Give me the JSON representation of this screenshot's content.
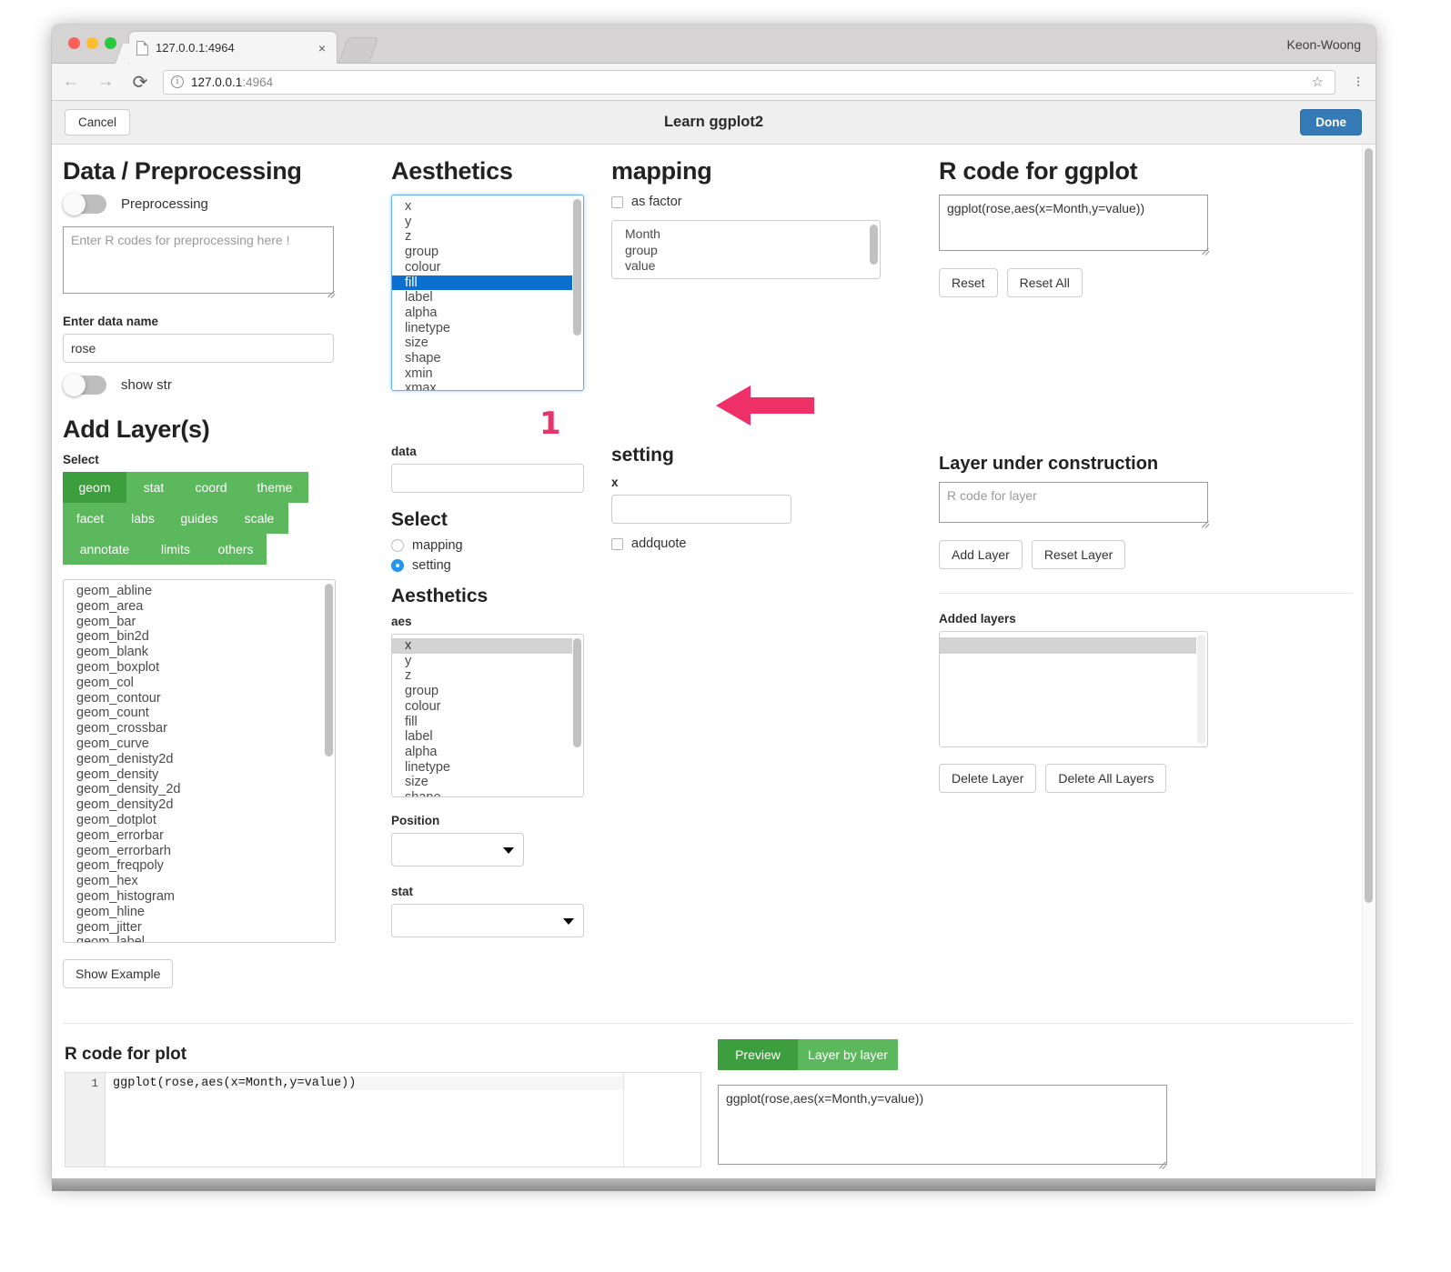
{
  "browser": {
    "tab_title": "127.0.0.1:4964",
    "tab_close": "×",
    "profile": "Keon-Woong",
    "url_host": "127.0.0.1",
    "url_port": ":4964",
    "back_icon": "←",
    "forward_icon": "→",
    "reload_icon": "⟳",
    "info_icon": "i",
    "star_icon": "☆"
  },
  "app": {
    "cancel_label": "Cancel",
    "title": "Learn ggplot2",
    "done_label": "Done"
  },
  "data_section": {
    "heading": "Data / Preprocessing",
    "preprocessing_toggle_label": "Preprocessing",
    "preprocessing_placeholder": "Enter R codes for preprocessing here !",
    "preprocessing_value": "",
    "data_name_label": "Enter data name",
    "data_name_value": "rose",
    "show_str_toggle_label": "show str"
  },
  "aesthetics_top": {
    "heading": "Aesthetics",
    "items": [
      "x",
      "y",
      "z",
      "group",
      "colour",
      "fill",
      "label",
      "alpha",
      "linetype",
      "size",
      "shape",
      "xmin",
      "xmax"
    ],
    "selected": "fill"
  },
  "mapping": {
    "heading": "mapping",
    "as_factor_label": "as factor",
    "as_factor_checked": false,
    "items": [
      "Month",
      "group",
      "value"
    ]
  },
  "r_code_ggplot": {
    "heading": "R code for ggplot",
    "value": "ggplot(rose,aes(x=Month,y=value))",
    "reset_label": "Reset",
    "reset_all_label": "Reset All"
  },
  "add_layers": {
    "heading": "Add Layer(s)",
    "select_label": "Select",
    "buttons": [
      {
        "label": "geom",
        "active": true
      },
      {
        "label": "stat",
        "active": false
      },
      {
        "label": "coord",
        "active": false
      },
      {
        "label": "theme",
        "active": false
      },
      {
        "label": "facet",
        "active": false
      },
      {
        "label": "labs",
        "active": false
      },
      {
        "label": "guides",
        "active": false
      },
      {
        "label": "scale",
        "active": false
      },
      {
        "label": "annotate",
        "active": false
      },
      {
        "label": "limits",
        "active": false
      },
      {
        "label": "others",
        "active": false
      }
    ],
    "geom_items": [
      "geom_abline",
      "geom_area",
      "geom_bar",
      "geom_bin2d",
      "geom_blank",
      "geom_boxplot",
      "geom_col",
      "geom_contour",
      "geom_count",
      "geom_crossbar",
      "geom_curve",
      "geom_denisty2d",
      "geom_density",
      "geom_density_2d",
      "geom_density2d",
      "geom_dotplot",
      "geom_errorbar",
      "geom_errorbarh",
      "geom_freqpoly",
      "geom_hex",
      "geom_histogram",
      "geom_hline",
      "geom_jitter",
      "geom_label"
    ],
    "show_example_label": "Show Example"
  },
  "layer_mid": {
    "data_label": "data",
    "data_value": "",
    "select_label": "Select",
    "radio_mapping_label": "mapping",
    "radio_setting_label": "setting",
    "radio_selected": "setting",
    "aesthetics_heading": "Aesthetics",
    "aes_label": "aes",
    "aes_items": [
      "x",
      "y",
      "z",
      "group",
      "colour",
      "fill",
      "label",
      "alpha",
      "linetype",
      "size",
      "shape"
    ],
    "aes_selected": "x",
    "position_label": "Position",
    "position_value": "",
    "stat_label": "stat",
    "stat_value": ""
  },
  "setting": {
    "heading": "setting",
    "x_label": "x",
    "x_value": "",
    "addquote_label": "addquote",
    "addquote_checked": false
  },
  "layer_construction": {
    "heading": "Layer under construction",
    "placeholder": "R code for layer",
    "value": "",
    "add_layer_label": "Add Layer",
    "reset_layer_label": "Reset Layer",
    "added_layers_label": "Added layers",
    "added_layers_items": [
      ""
    ],
    "delete_layer_label": "Delete Layer",
    "delete_all_layers_label": "Delete All Layers"
  },
  "r_code_plot": {
    "heading": "R code for plot",
    "line_number": "1",
    "code": "ggplot(rose,aes(x=Month,y=value))"
  },
  "preview": {
    "preview_label": "Preview",
    "layer_by_layer_label": "Layer by layer",
    "active_tab": "Preview",
    "code_value": "ggplot(rose,aes(x=Month,y=value))"
  },
  "annotations": {
    "step_number": "1",
    "arrow_color": "#e8336d"
  },
  "colors": {
    "accent_blue": "#337ab7",
    "green": "#5cb85c",
    "green_active": "#3d9e3d",
    "select_blue": "#0b6fd0",
    "annotation_pink": "#e8336d"
  }
}
